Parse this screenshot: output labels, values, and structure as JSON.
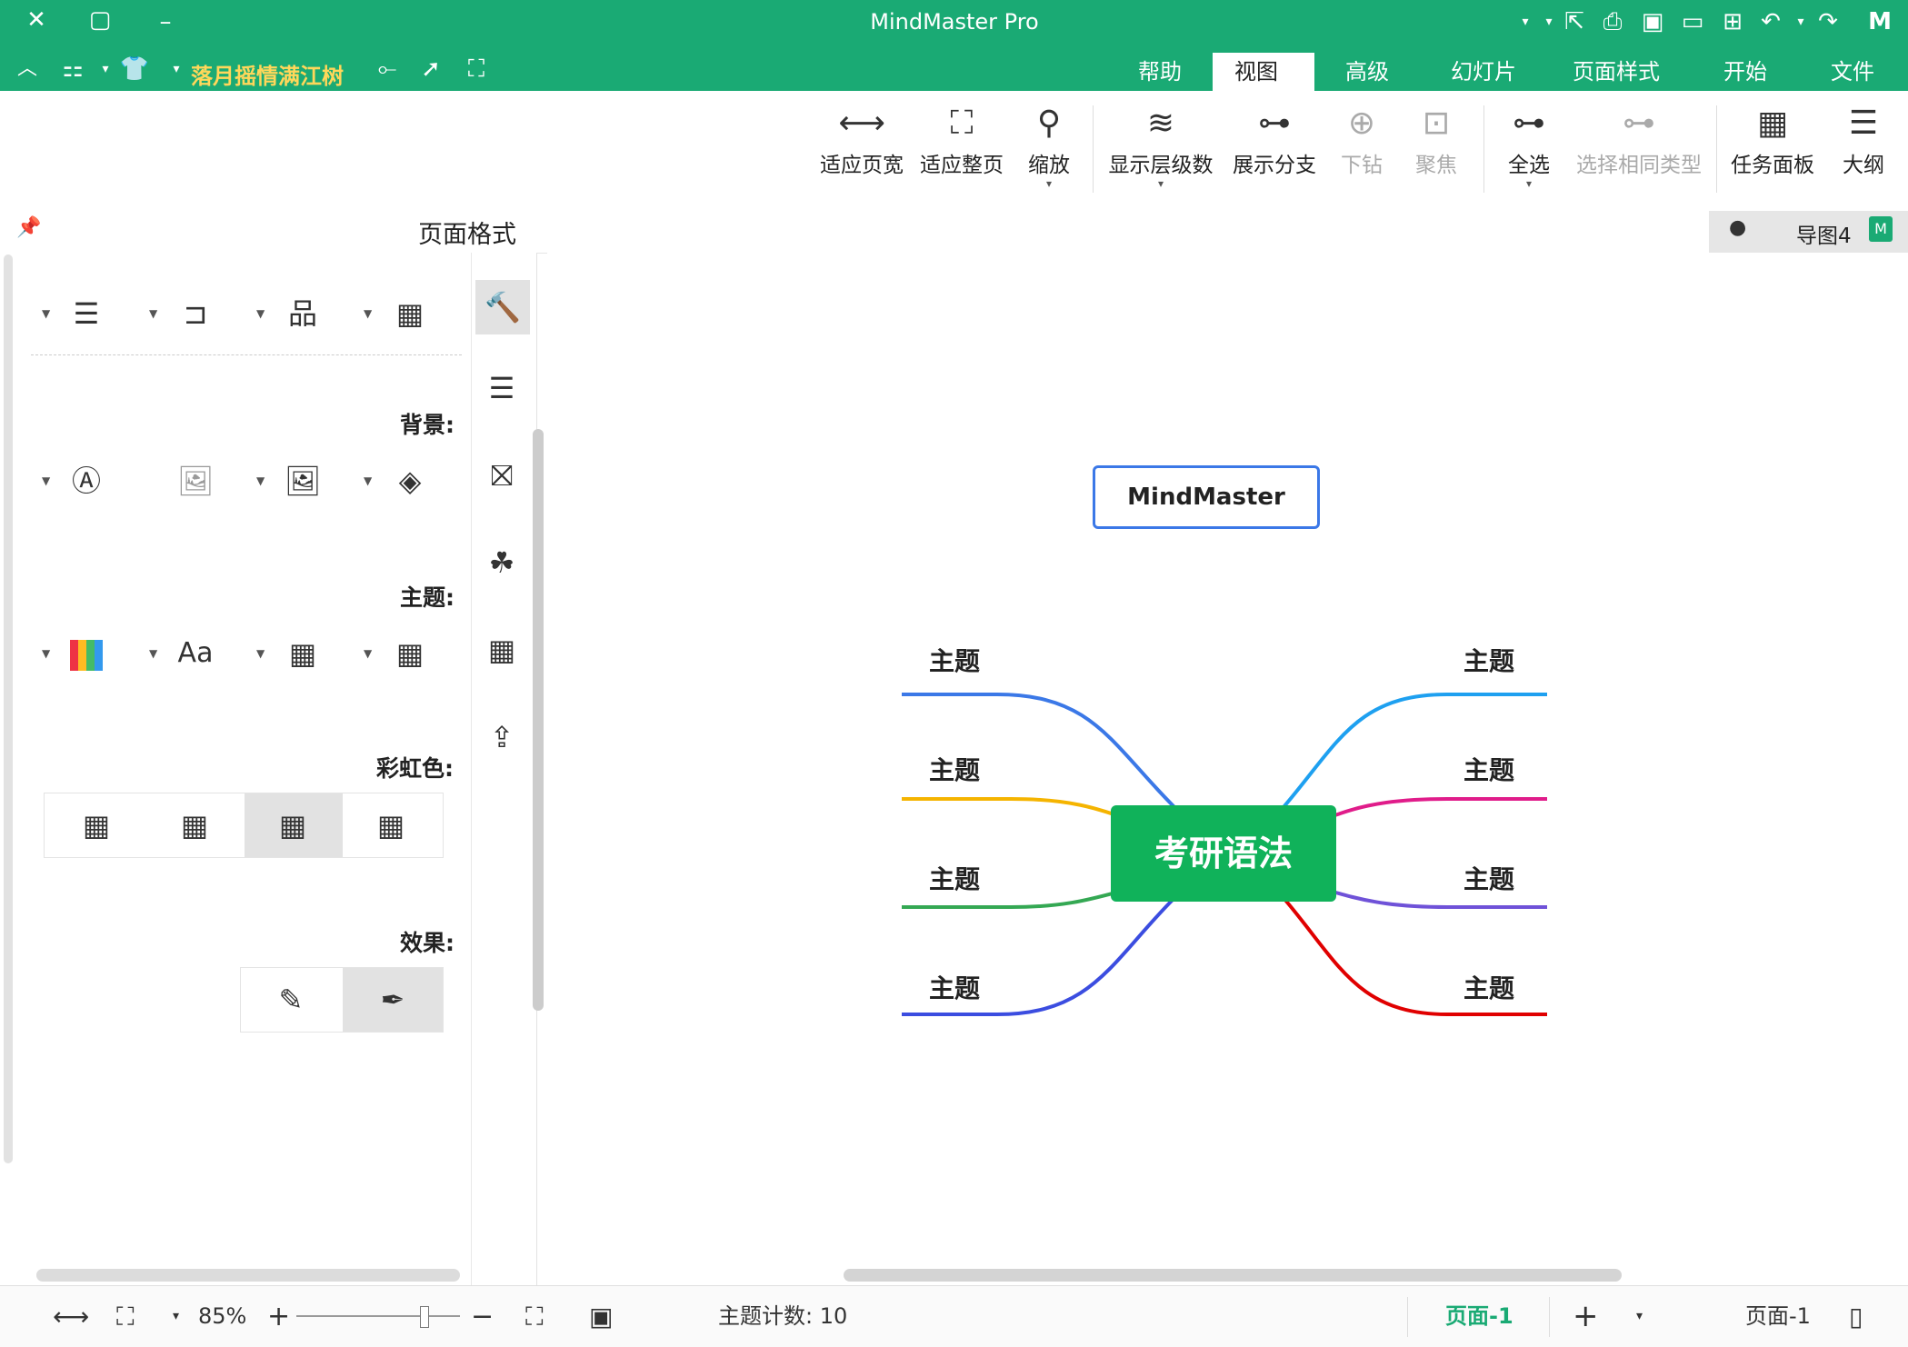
{
  "app": {
    "title": "MindMaster Pro",
    "user": "落月摇情满江树"
  },
  "colors": {
    "brand": "#1aaa74",
    "central": "#10b25a",
    "accent_blue": "#3b78e7",
    "active_page": "#1aaa74"
  },
  "tabs": {
    "file": "文件",
    "start": "开始",
    "page_style": "页面样式",
    "slides": "幻灯片",
    "advanced": "高级",
    "view": "视图",
    "help": "帮助"
  },
  "ribbon": {
    "outline": "大纲",
    "task_panel": "任务面板",
    "select_same": "选择相同类型",
    "select_all": "全选",
    "focus": "聚焦",
    "drill_down": "下钻",
    "show_branch": "展示分支",
    "show_levels": "显示层级数",
    "zoom": "缩放",
    "fit_page": "适应整页",
    "fit_width": "适应页宽"
  },
  "doc": {
    "tab_name": "导图4"
  },
  "panel": {
    "title": "页面格式",
    "background_label": "背景:",
    "theme_label": "主题:",
    "rainbow_label": "彩虹色:",
    "effect_label": "效果:"
  },
  "map": {
    "floating": "MindMaster",
    "central": "考研语法",
    "topics": [
      "主题",
      "主题",
      "主题",
      "主题",
      "主题",
      "主题",
      "主题",
      "主题"
    ]
  },
  "status": {
    "page_left": "页面-1",
    "page_active": "页面-1",
    "topic_count": "主题计数: 10",
    "zoom": "85%"
  },
  "icons": [
    "logo-icon",
    "redo-icon",
    "undo-icon",
    "new-icon",
    "open-icon",
    "save-icon",
    "print-icon",
    "export-icon",
    "arrow-icon",
    "share-icon",
    "select-icon",
    "fullscreen-icon"
  ]
}
